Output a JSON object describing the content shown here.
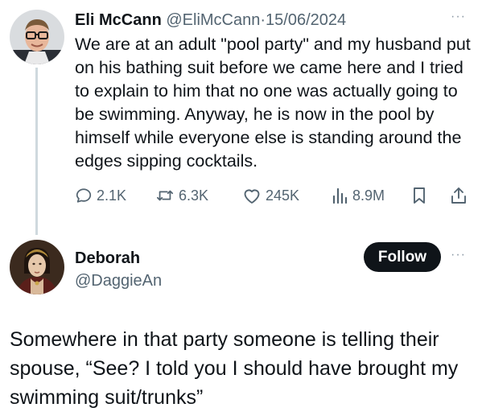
{
  "tweet": {
    "author_name": "Eli McCann",
    "author_handle": "@EliMcCann",
    "separator": "·",
    "date": "15/06/2024",
    "more_label": "···",
    "text": "We are at an adult \"pool party\" and my husband put on his bathing suit before we came here and I tried to explain to him that no one was actually going to be swimming. Anyway, he is now in the pool by himself while everyone else is standing around the edges sipping cocktails.",
    "actions": {
      "replies": "2.1K",
      "reposts": "6.3K",
      "likes": "245K",
      "views": "8.9M"
    },
    "icons": {
      "reply": "reply-icon",
      "repost": "repost-icon",
      "like": "heart-icon",
      "views": "views-bar-chart-icon",
      "bookmark": "bookmark-icon",
      "share": "share-icon"
    }
  },
  "reply": {
    "author_name": "Deborah",
    "author_handle": "@DaggieAn",
    "follow_label": "Follow",
    "more_label": "···",
    "text": "Somewhere in that party someone is telling their spouse, “See?  I told you I should have brought my swimming suit/trunks”"
  },
  "colors": {
    "text_primary": "#0f1419",
    "text_secondary": "#536471",
    "follow_bg": "#0f1419",
    "thread_line": "#cfd9de"
  }
}
